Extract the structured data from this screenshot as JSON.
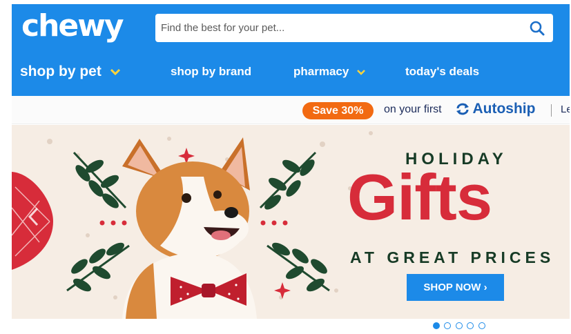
{
  "header": {
    "logo": "chewy",
    "search": {
      "placeholder": "Find the best for your pet..."
    },
    "nav": [
      {
        "label": "shop by pet"
      },
      {
        "label": "shop by brand"
      },
      {
        "label": "pharmacy"
      },
      {
        "label": "today's deals"
      }
    ]
  },
  "promo": {
    "badge": "Save 30%",
    "text": "on your first",
    "brand": "Autoship",
    "cut_text": "Le"
  },
  "banner": {
    "line1": "HOLIDAY",
    "headline": "Gifts",
    "line3": "AT GREAT PRICES",
    "cta": "SHOP NOW ›"
  },
  "carousel": {
    "slides": 5,
    "active": 1
  },
  "colors": {
    "brand_blue": "#1c8ae8",
    "promo_orange": "#f26a12",
    "headline_red": "#d72c3a",
    "dark_green": "#173b26",
    "accent_yellow": "#ffd43b"
  }
}
